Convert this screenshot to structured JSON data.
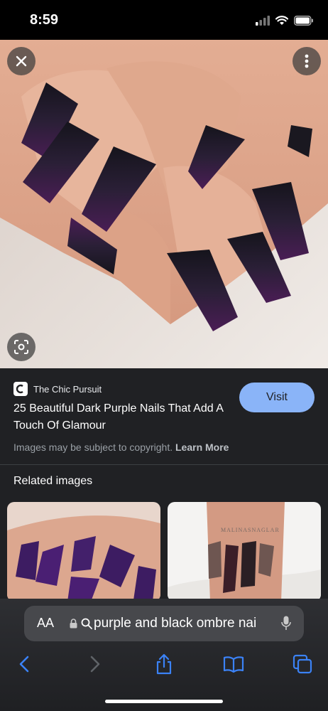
{
  "status": {
    "time": "8:59"
  },
  "result": {
    "source_name": "The Chic Pursuit",
    "title": "25 Beautiful Dark Purple Nails That Add A Touch Of Glamour",
    "visit_label": "Visit",
    "copyright_text": "Images may be subject to copyright.",
    "learn_more_label": "Learn More"
  },
  "related": {
    "title": "Related images",
    "thumb2_watermark": "MALINASNAGLAR"
  },
  "browser": {
    "aa_label": "AA",
    "url_text": "purple and black ombre nai"
  },
  "icons": {
    "close": "close-icon",
    "more": "more-vert-icon",
    "lens": "lens-icon",
    "back": "chevron-left-icon",
    "forward": "chevron-right-icon",
    "share": "share-icon",
    "bookmarks": "book-icon",
    "tabs": "tabs-icon"
  },
  "colors": {
    "visit_button": "#8ab4f8",
    "panel_bg": "#202124",
    "toolbar_blue": "#3b82f6"
  }
}
